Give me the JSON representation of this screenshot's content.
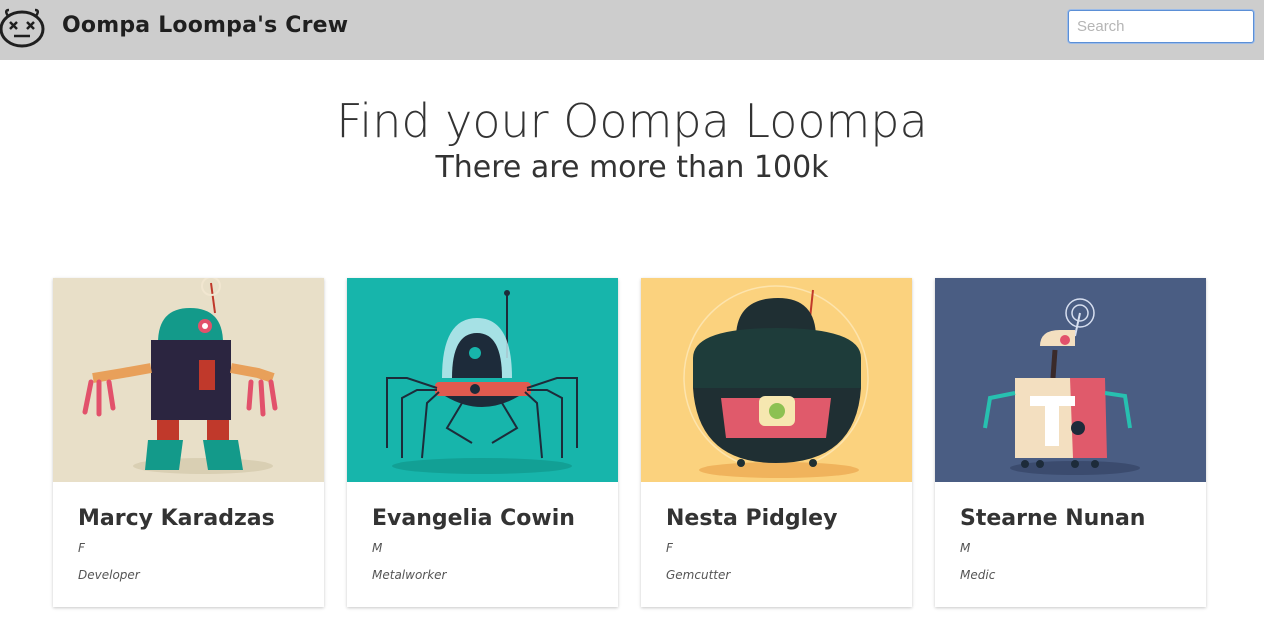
{
  "header": {
    "app_title": "Oompa Loompa's Crew",
    "search_placeholder": "Search",
    "search_value": ""
  },
  "hero": {
    "title": "Find your Oompa Loompa",
    "subtitle": "There are more than 100k"
  },
  "cards": [
    {
      "name": "Marcy Karadzas",
      "gender": "F",
      "profession": "Developer",
      "image_bg": "#e8dfc8",
      "image_icon": "robot-illustration-icon"
    },
    {
      "name": "Evangelia Cowin",
      "gender": "M",
      "profession": "Metalworker",
      "image_bg": "#17b5ab",
      "image_icon": "spider-robot-illustration-icon"
    },
    {
      "name": "Nesta Pidgley",
      "gender": "F",
      "profession": "Gemcutter",
      "image_bg": "#fbd27e",
      "image_icon": "round-robot-illustration-icon"
    },
    {
      "name": "Stearne Nunan",
      "gender": "M",
      "profession": "Medic",
      "image_bg": "#4a5d83",
      "image_icon": "medic-robot-illustration-icon"
    }
  ]
}
